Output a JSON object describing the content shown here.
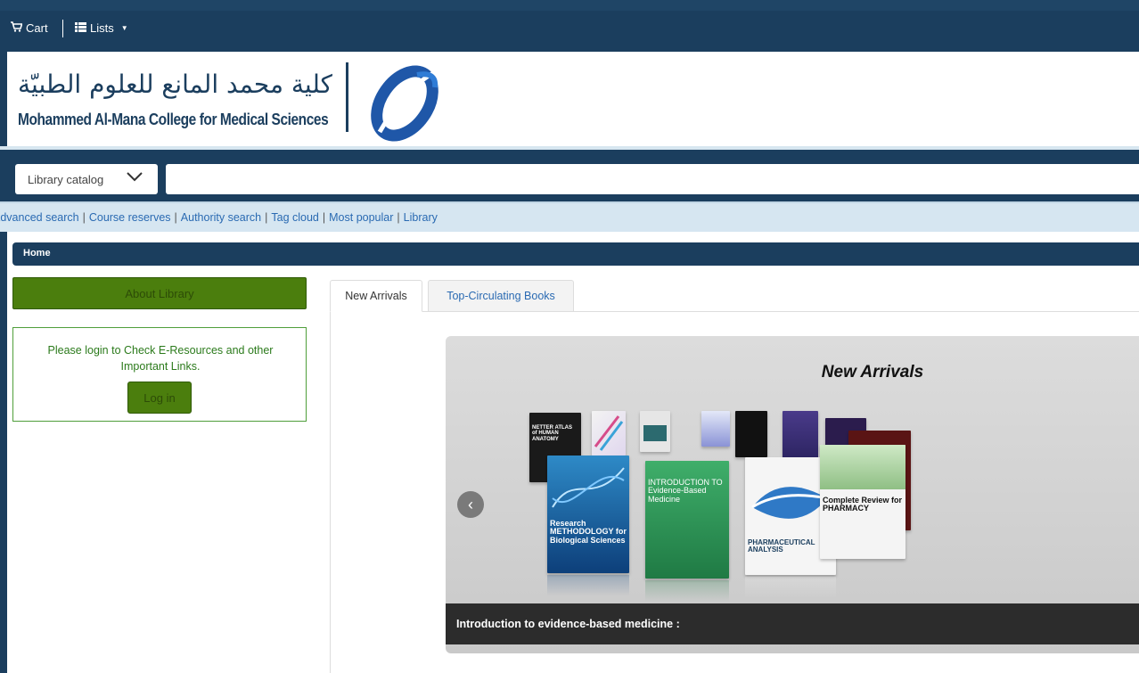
{
  "topnav": {
    "cart_label": "Cart",
    "lists_label": "Lists"
  },
  "header": {
    "arabic_name": "كلية محمد المانع للعلوم الطبيّة",
    "english_name": "Mohammed Al-Mana College for Medical Sciences"
  },
  "search": {
    "scope_selected": "Library catalog",
    "query_value": ""
  },
  "links": [
    "Advanced search",
    "Course reserves",
    "Authority search",
    "Tag cloud",
    "Most popular",
    "Library"
  ],
  "breadcrumb": {
    "home": "Home"
  },
  "sidebar": {
    "about_label": "About Library",
    "login_message": "Please login to Check E-Resources and other Important Links.",
    "login_button": "Log in"
  },
  "tabs": [
    {
      "label": "New Arrivals",
      "active": true
    },
    {
      "label": "Top-Circulating Books",
      "active": false
    }
  ],
  "carousel": {
    "title": "New Arrivals",
    "caption": "Introduction to evidence-based medicine :",
    "books": [
      {
        "title": "NETTER ATLAS of HUMAN ANATOMY"
      },
      {
        "title": "Research METHODOLOGY for Biological Sciences"
      },
      {
        "title": "INTRODUCTION TO Evidence-Based Medicine"
      },
      {
        "title": "PHARMACEUTICAL ANALYSIS"
      },
      {
        "title": "Complete Review for PHARMACY"
      }
    ]
  },
  "colors": {
    "navy": "#1b3e5e",
    "green": "#4b7e0d",
    "link_blue": "#2a6ab2"
  }
}
